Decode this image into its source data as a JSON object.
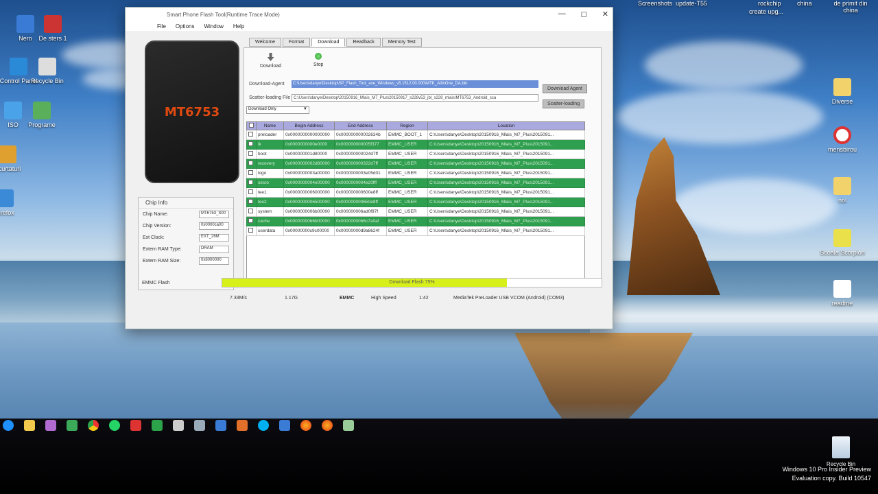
{
  "top_labels": [
    "Screenshots",
    "update-T55",
    "create upg...",
    "rockchip",
    "china",
    "de primit  din china"
  ],
  "desktop_left_icons": [
    "Nero",
    "De sters 1",
    "Control Panel",
    "Recycle Bin",
    "ISO",
    "Programe",
    "Scurtaturi",
    "Firefox"
  ],
  "desktop_right_icons": [
    {
      "label": "Diverse"
    },
    {
      "label": "mensbirou"
    },
    {
      "label": "nol"
    },
    {
      "label": "Scoala Scorpion"
    },
    {
      "label": "readme"
    }
  ],
  "window": {
    "title": "Smart Phone Flash Tool(Runtime Trace Mode)",
    "menu": [
      "File",
      "Options",
      "Window",
      "Help"
    ],
    "phone_model": "MT6753",
    "tabs": [
      "Welcome",
      "Format",
      "Download",
      "Readback",
      "Memory Test"
    ],
    "active_tab": "Download",
    "toolbar": {
      "download_label": "Download",
      "stop_label": "Stop"
    },
    "download_agent": {
      "label": "Download-Agent",
      "value": "C:\\Users\\danye\\Desktop\\SP_Flash_Tool_exe_Windows_v5.1512.00.000\\MTK_AllInOne_DA.bin",
      "button": "Download Agent"
    },
    "scatter": {
      "label": "Scatter-loading File",
      "value": "C:\\Users\\danye\\Desktop\\20150916_Mlais_M7_Plus\\20150917_s228v53_jbl_s228_mlais\\MT6753_Android_sca",
      "button": "Scatter-loading"
    },
    "mode_select": "Download Only",
    "table": {
      "headers": [
        "",
        "Name",
        "Begin Address",
        "End Address",
        "Region",
        "Location"
      ],
      "rows": [
        {
          "name": "preloader",
          "begin": "0x0000000000000000",
          "end": "0x000000000002634b",
          "region": "EMMC_BOOT_1",
          "location": "C:\\Users\\danye\\Desktop\\20150916_Mlais_M7_Plus\\2015091...",
          "style": "white"
        },
        {
          "name": "lk",
          "begin": "0x0000000000e0000",
          "end": "0x000000000005f377",
          "region": "EMMC_USER",
          "location": "C:\\Users\\danye\\Desktop\\20150916_Mlais_M7_Plus\\2015091...",
          "style": "green"
        },
        {
          "name": "boot",
          "begin": "0x000000001d80000",
          "end": "0x000000000024d7ff",
          "region": "EMMC_USER",
          "location": "C:\\Users\\danye\\Desktop\\20150916_Mlais_M7_Plus\\2015091...",
          "style": "white"
        },
        {
          "name": "recovery",
          "begin": "0x0000000002d80000",
          "end": "0x000000000322d7ff",
          "region": "EMMC_USER",
          "location": "C:\\Users\\danye\\Desktop\\20150916_Mlais_M7_Plus\\2015091...",
          "style": "green"
        },
        {
          "name": "logo",
          "begin": "0x0000000003a00000",
          "end": "0x0000000003e05d01",
          "region": "EMMC_USER",
          "location": "C:\\Users\\danye\\Desktop\\20150916_Mlais_M7_Plus\\2015091...",
          "style": "white"
        },
        {
          "name": "secro",
          "begin": "0x0000000004e00000",
          "end": "0x0000000004e20fff",
          "region": "EMMC_USER",
          "location": "C:\\Users\\danye\\Desktop\\20150916_Mlais_M7_Plus\\2015091...",
          "style": "green"
        },
        {
          "name": "tee1",
          "begin": "0x0000000006000000",
          "end": "0x000000000600e8ff",
          "region": "EMMC_USER",
          "location": "C:\\Users\\danye\\Desktop\\20150916_Mlais_M7_Plus\\2015091...",
          "style": "white"
        },
        {
          "name": "tee2",
          "begin": "0x0000000006500000",
          "end": "0x000000000650e8ff",
          "region": "EMMC_USER",
          "location": "C:\\Users\\danye\\Desktop\\20150916_Mlais_M7_Plus\\2015091...",
          "style": "green"
        },
        {
          "name": "system",
          "begin": "0x0000000006b00000",
          "end": "0x000000006ad0f97f",
          "region": "EMMC_USER",
          "location": "C:\\Users\\danye\\Desktop\\20150916_Mlais_M7_Plus\\2015091...",
          "style": "white"
        },
        {
          "name": "cache",
          "begin": "0x00000000b6b00000",
          "end": "0x00000000b6c7a0af",
          "region": "EMMC_USER",
          "location": "C:\\Users\\danye\\Desktop\\20150916_Mlais_M7_Plus\\2015091...",
          "style": "green"
        },
        {
          "name": "userdata",
          "begin": "0x00000000c9c00000",
          "end": "0x00000000d9a8624f",
          "region": "EMMC_USER",
          "location": "C:\\Users\\danye\\Desktop\\20150916_Mlais_M7_Plus\\2015091...",
          "style": "white"
        }
      ]
    },
    "chip_info": {
      "header": "Chip Info",
      "rows": [
        {
          "label": "Chip Name:",
          "value": "MT6753_S00"
        },
        {
          "label": "Chip Version:",
          "value": "0x0000ca00"
        },
        {
          "label": "Ext Clock:",
          "value": "EXT_26M"
        },
        {
          "label": "Extern RAM Type:",
          "value": "DRAM"
        },
        {
          "label": "Extern RAM Size:",
          "value": "0x8000000"
        }
      ],
      "emmc_flash": "EMMC Flash"
    },
    "progress": {
      "text": "Download Flash 75%",
      "percent": 75
    },
    "status": {
      "speed": "7.33M/s",
      "size": "1.17G",
      "storage": "EMMC",
      "mode": "High Speed",
      "time": "1:42",
      "port": "MediaTek PreLoader USB VCOM (Android) (COM3)"
    }
  },
  "recycle_bin_label": "Recycle Bin",
  "watermark": {
    "line1": "Windows 10 Pro Insider Preview",
    "line2": "Evaluation copy. Build 10547"
  }
}
